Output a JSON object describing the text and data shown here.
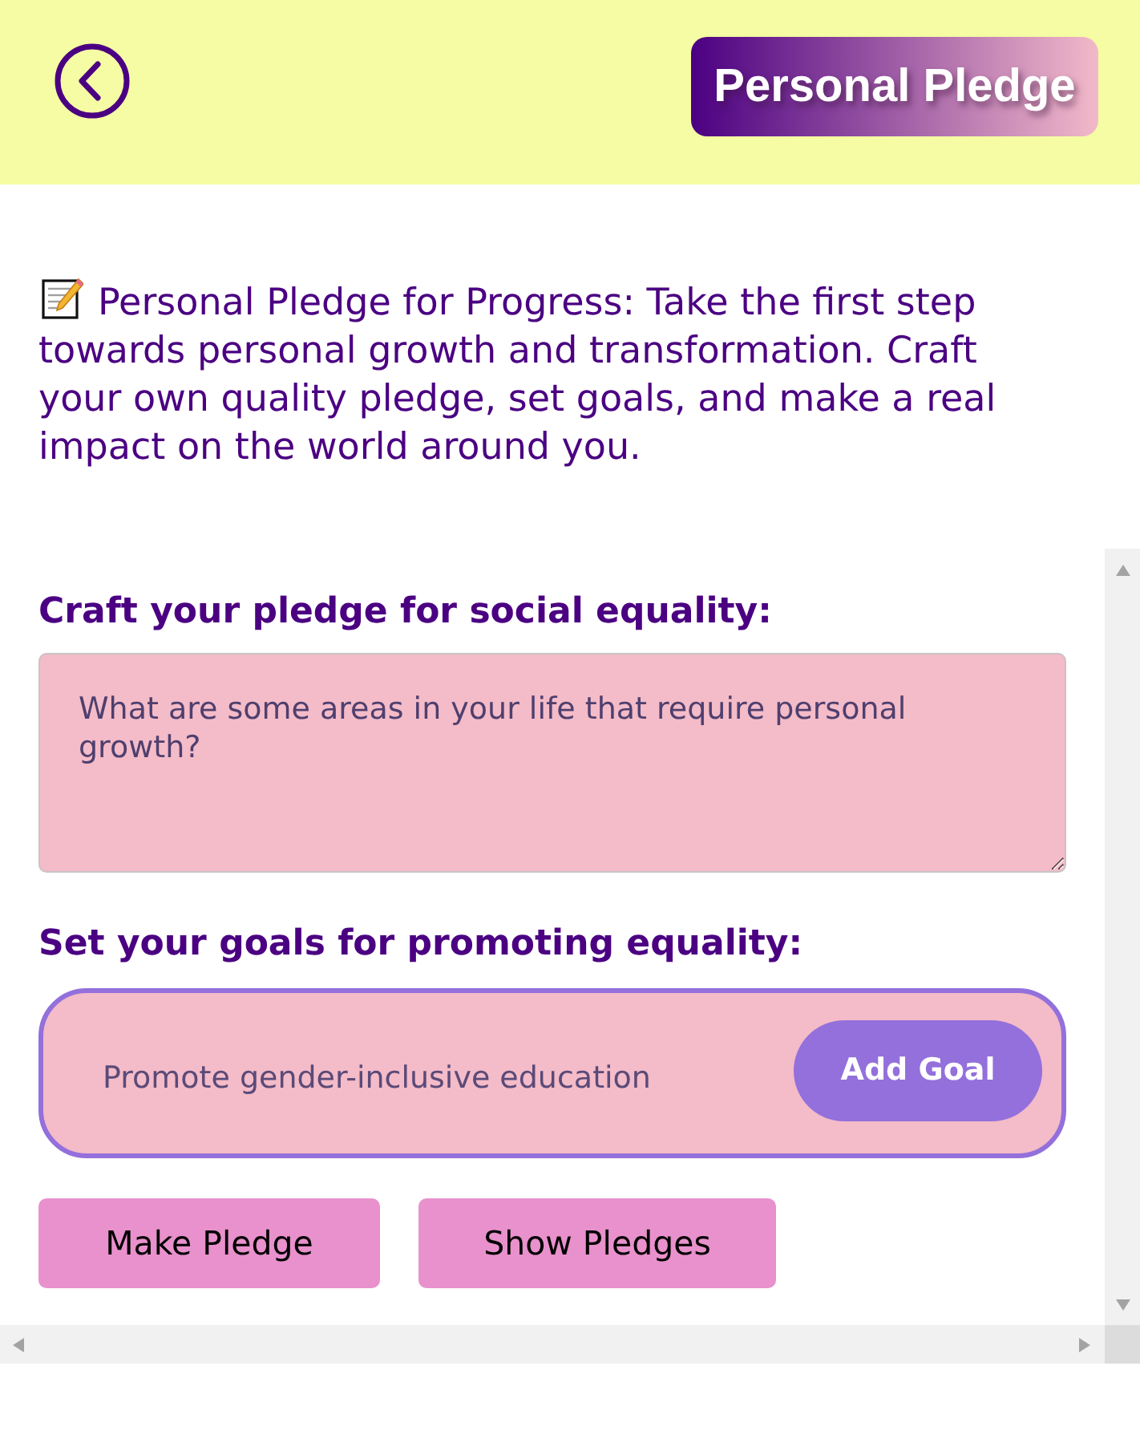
{
  "header": {
    "title": "Personal Pledge"
  },
  "intro": {
    "text": "Personal Pledge for Progress: Take the first step towards personal growth and transformation. Craft your own quality pledge, set goals, and make a real impact on the world around you."
  },
  "pledge_section": {
    "heading": "Craft your pledge for social equality:",
    "textarea": {
      "placeholder": "What are some areas in your life that require personal growth?"
    }
  },
  "goals_section": {
    "heading": "Set your goals for promoting equality:",
    "input": {
      "placeholder": "Promote gender-inclusive education"
    },
    "button": "Add Goal"
  },
  "actions": [
    "Make Pledge",
    "Show Pledges"
  ]
}
